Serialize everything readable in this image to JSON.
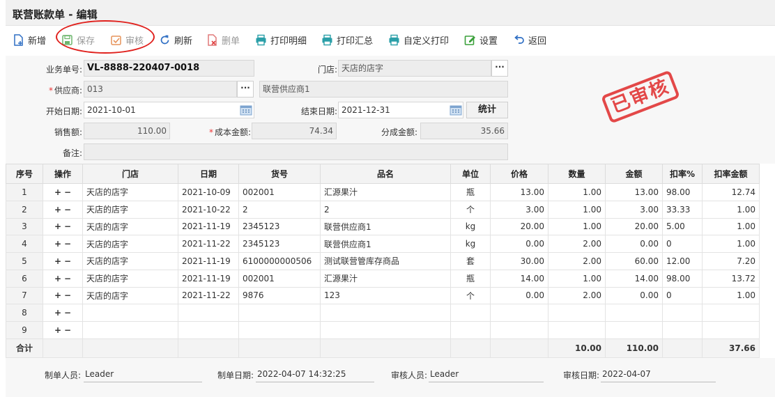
{
  "window": {
    "title": "联营账款单 - 编辑"
  },
  "toolbar": {
    "add": "新增",
    "save": "保存",
    "audit": "审核",
    "refresh": "刷新",
    "delete": "删单",
    "print_detail": "打印明细",
    "print_summary": "打印汇总",
    "custom_print": "自定义打印",
    "settings": "设置",
    "back": "返回"
  },
  "form": {
    "doc_no_label": "业务单号:",
    "doc_no": "VL-8888-220407-0018",
    "store_label": "门店:",
    "store": "天店的店字",
    "supplier_label": "供应商:",
    "supplier_code": "013",
    "supplier_name": "联营供应商1",
    "start_date_label": "开始日期:",
    "start_date": "2021-10-01",
    "end_date_label": "结束日期:",
    "end_date": "2021-12-31",
    "stat_button": "统计",
    "sales_label": "销售额:",
    "sales": "110.00",
    "cost_label": "成本金额:",
    "cost": "74.34",
    "share_label": "分成金额:",
    "share": "35.66",
    "remark_label": "备注:",
    "remark": "",
    "ellipsis": "···"
  },
  "stamp": {
    "text": "已审核",
    "color": "#e23a3a"
  },
  "table": {
    "headers": [
      "序号",
      "操作",
      "门店",
      "日期",
      "货号",
      "品名",
      "单位",
      "价格",
      "数量",
      "金额",
      "扣率%",
      "扣率金额"
    ],
    "op_plus": "+",
    "op_minus": "−",
    "rows": [
      {
        "idx": "1",
        "store": "天店的店字",
        "date": "2021-10-09",
        "code": "002001",
        "name": "汇源果汁",
        "unit": "瓶",
        "price": "13.00",
        "qty": "1.00",
        "amount": "13.00",
        "rate": "98.00",
        "rate_amount": "12.74"
      },
      {
        "idx": "2",
        "store": "天店的店字",
        "date": "2021-10-22",
        "code": "2",
        "name": "2",
        "unit": "个",
        "price": "3.00",
        "qty": "1.00",
        "amount": "3.00",
        "rate": "33.33",
        "rate_amount": "1.00"
      },
      {
        "idx": "3",
        "store": "天店的店字",
        "date": "2021-11-19",
        "code": "2345123",
        "name": "联营供应商1",
        "unit": "kg",
        "price": "20.00",
        "qty": "1.00",
        "amount": "20.00",
        "rate": "5.00",
        "rate_amount": "1.00"
      },
      {
        "idx": "4",
        "store": "天店的店字",
        "date": "2021-11-22",
        "code": "2345123",
        "name": "联营供应商1",
        "unit": "kg",
        "price": "0.00",
        "qty": "2.00",
        "amount": "0.00",
        "rate": "0",
        "rate_amount": "1.00"
      },
      {
        "idx": "5",
        "store": "天店的店字",
        "date": "2021-11-19",
        "code": "6100000000506",
        "name": "测试联营管库存商品",
        "unit": "套",
        "price": "30.00",
        "qty": "2.00",
        "amount": "60.00",
        "rate": "12.00",
        "rate_amount": "7.20"
      },
      {
        "idx": "6",
        "store": "天店的店字",
        "date": "2021-11-19",
        "code": "002001",
        "name": "汇源果汁",
        "unit": "瓶",
        "price": "14.00",
        "qty": "1.00",
        "amount": "14.00",
        "rate": "98.00",
        "rate_amount": "13.72"
      },
      {
        "idx": "7",
        "store": "天店的店字",
        "date": "2021-11-22",
        "code": "9876",
        "name": "123",
        "unit": "个",
        "price": "0.00",
        "qty": "2.00",
        "amount": "0.00",
        "rate": "0",
        "rate_amount": "1.00"
      },
      {
        "idx": "8",
        "store": "",
        "date": "",
        "code": "",
        "name": "",
        "unit": "",
        "price": "",
        "qty": "",
        "amount": "",
        "rate": "",
        "rate_amount": ""
      },
      {
        "idx": "9",
        "store": "",
        "date": "",
        "code": "",
        "name": "",
        "unit": "",
        "price": "",
        "qty": "",
        "amount": "",
        "rate": "",
        "rate_amount": ""
      }
    ],
    "total": {
      "label": "合计",
      "qty": "10.00",
      "amount": "110.00",
      "rate_amount": "37.66"
    }
  },
  "footer": {
    "creator_label": "制单人员:",
    "creator": "Leader",
    "create_date_label": "制单日期:",
    "create_date": "2022-04-07 14:32:25",
    "auditor_label": "审核人员:",
    "auditor": "Leader",
    "audit_date_label": "审核日期:",
    "audit_date": "2022-04-07"
  }
}
